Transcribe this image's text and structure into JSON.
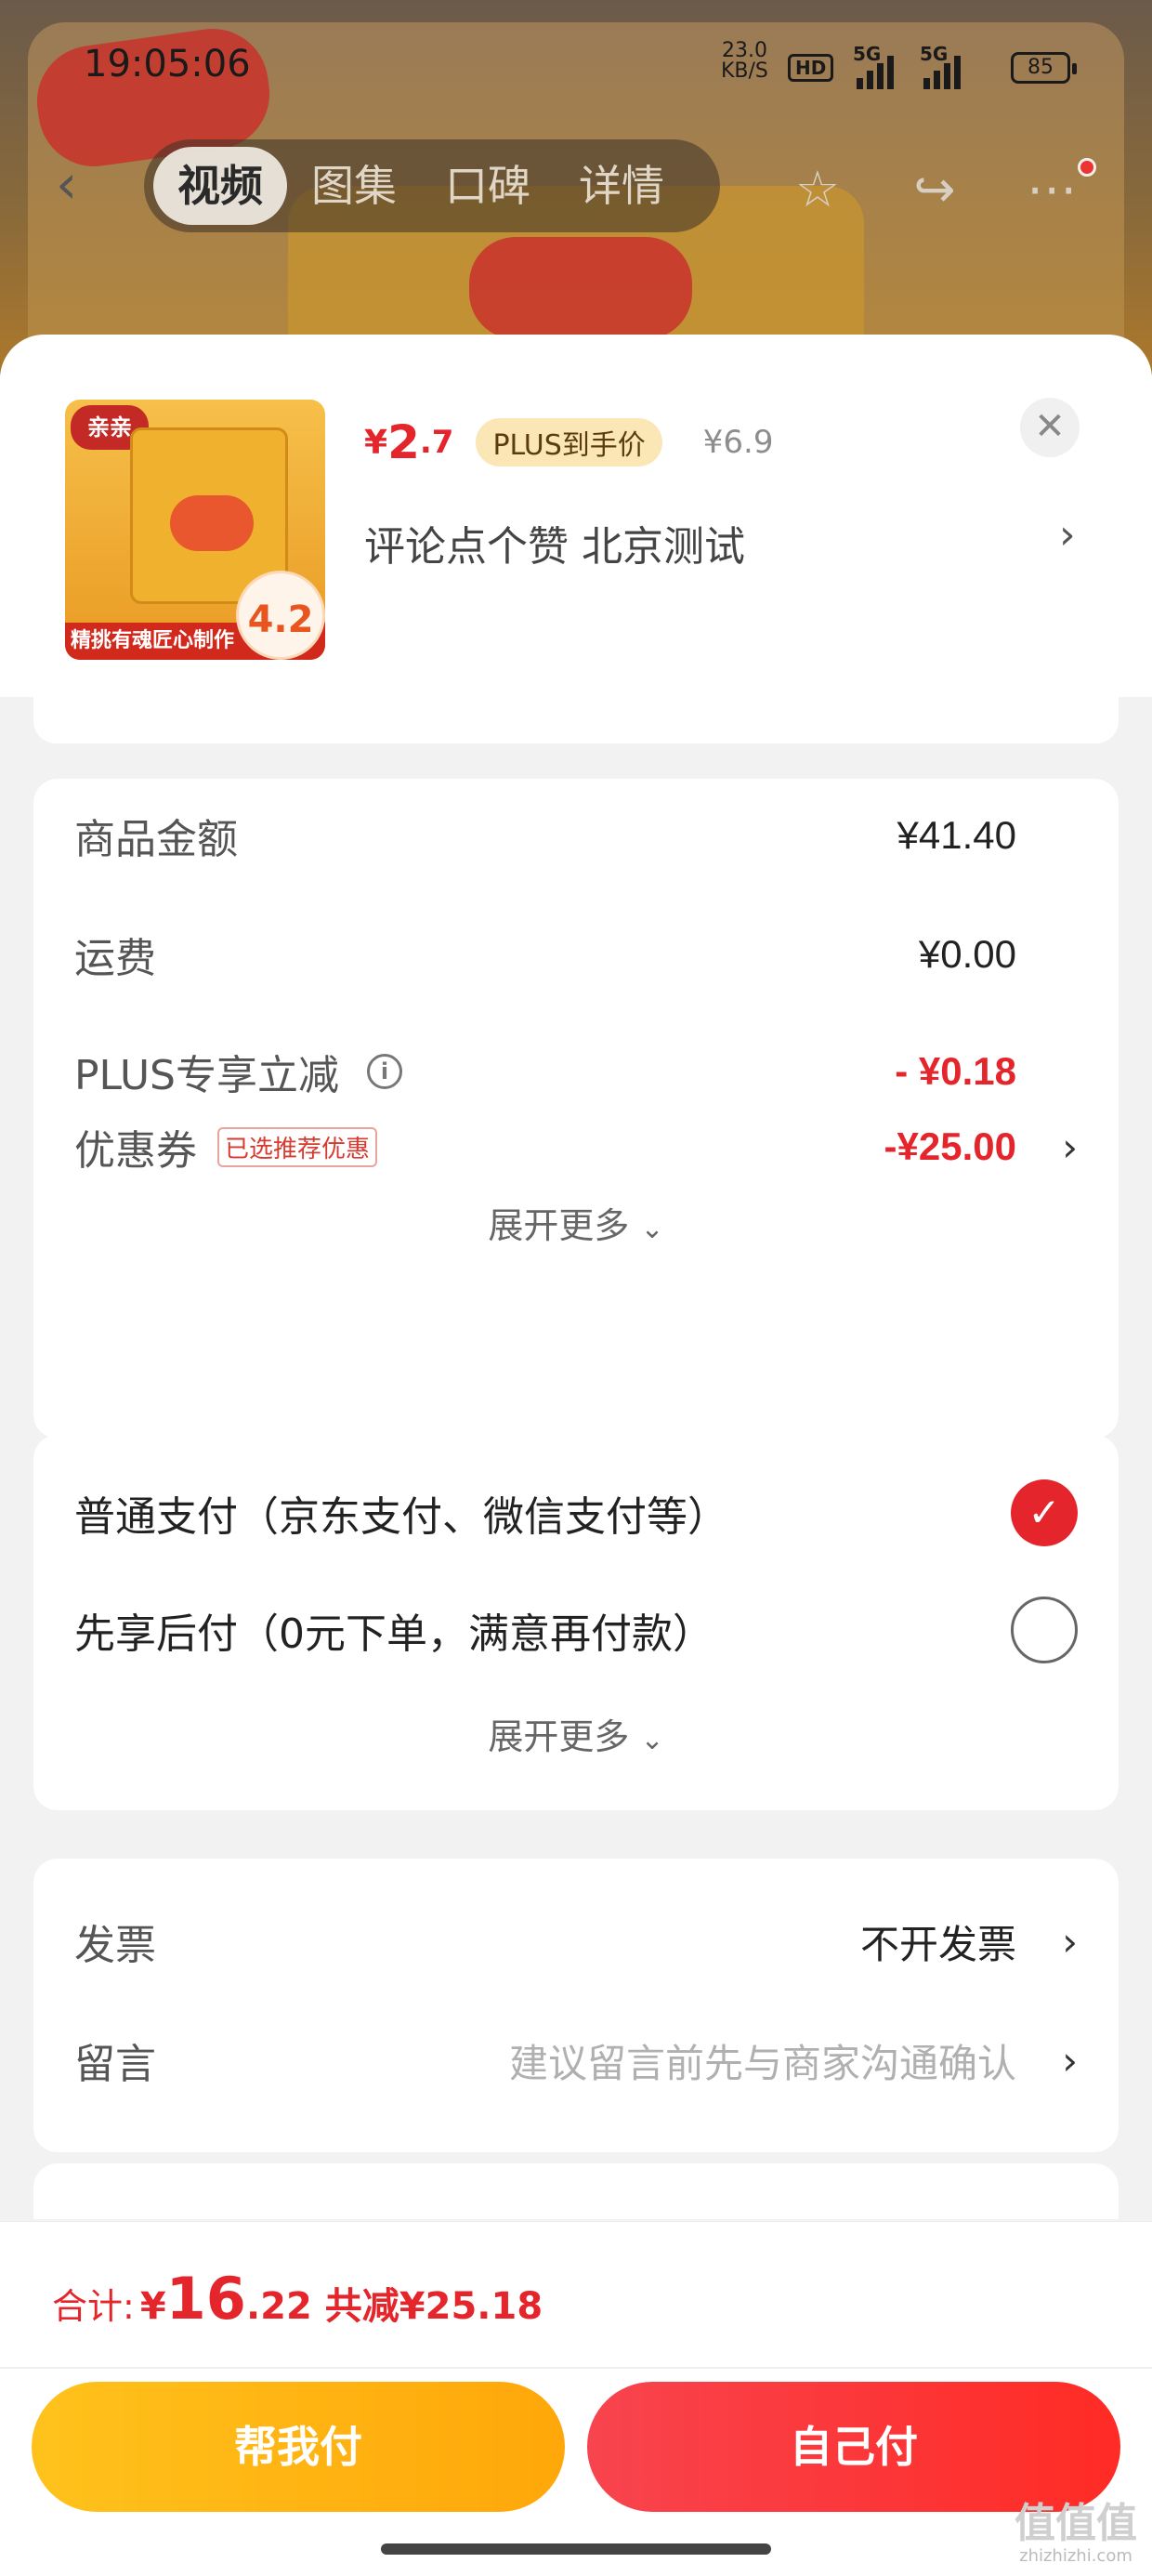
{
  "status_bar": {
    "time": "19:05:06",
    "net_speed_value": "23.0",
    "net_speed_unit": "KB/S",
    "hd_label": "HD",
    "sim1": "5G",
    "sim2": "5G",
    "battery": "85"
  },
  "top_nav": {
    "tabs": [
      {
        "label": "视频",
        "active": true
      },
      {
        "label": "图集",
        "active": false
      },
      {
        "label": "口碑",
        "active": false
      },
      {
        "label": "详情",
        "active": false
      }
    ],
    "icons": [
      "back-icon",
      "star-icon",
      "share-icon",
      "more-icon"
    ]
  },
  "product": {
    "thumb_logo": "亲亲",
    "thumb_banner": "精挑有魂匠心制作",
    "thumb_price": "4.2",
    "price_currency": "¥",
    "price_int": "2",
    "price_dec": ".7",
    "plus_badge": "PLUS到手价",
    "orig_price": "¥6.9",
    "description": "评论点个赞  北京测试"
  },
  "summary": {
    "goods_amount": {
      "label": "商品金额",
      "value": "¥41.40"
    },
    "shipping": {
      "label": "运费",
      "value": "¥0.00"
    },
    "plus_discount": {
      "label": "PLUS专享立减",
      "value": "- ¥0.18"
    },
    "coupon": {
      "label": "优惠券",
      "tag": "已选推荐优惠",
      "value": "-¥25.00"
    },
    "expand": "展开更多"
  },
  "payment": {
    "options": [
      {
        "label": "普通支付（京东支付、微信支付等）",
        "selected": true
      },
      {
        "label": "先享后付（0元下单，满意再付款）",
        "selected": false
      }
    ],
    "expand": "展开更多"
  },
  "extra": {
    "invoice": {
      "label": "发票",
      "value": "不开发票"
    },
    "message": {
      "label": "留言",
      "placeholder": "建议留言前先与商家沟通确认"
    }
  },
  "footer": {
    "total_label": "合计:",
    "total_currency": "¥",
    "total_int": "16",
    "total_dec": ".22",
    "total_save": "共减¥25.18",
    "help_pay": "帮我付",
    "self_pay": "自己付"
  },
  "watermark": {
    "logo": "值值值",
    "site": "zhizhizhi.com"
  },
  "colors": {
    "accent_red": "#e4262c",
    "accent_yellow": "#ffb414",
    "plus_badge_bg": "#fbe7b6"
  }
}
